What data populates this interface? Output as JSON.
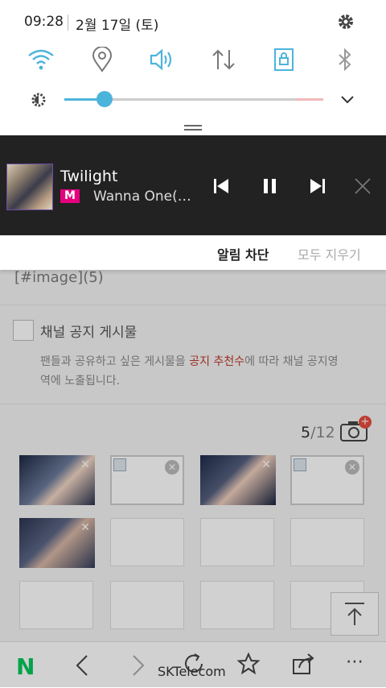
{
  "status": {
    "time": "09:28",
    "date": "2월 17일 (토)"
  },
  "media": {
    "title": "Twilight",
    "artist": "Wanna One(…",
    "app_logo": "M"
  },
  "actions": {
    "block_label": "알림 차단",
    "clear_all_label": "모두 지우기"
  },
  "page": {
    "image_placeholder": "[#image](5)",
    "notice_title": "채널 공지 게시물",
    "notice_desc_part1": "팬들과 공유하고 싶은 게시물을 ",
    "notice_desc_highlight": "공지 추천수",
    "notice_desc_part2": "에 따라 채널 공지영",
    "notice_desc_line2": "역에 노출됩니다.",
    "count_current": "5",
    "count_total": "/12"
  },
  "bottom_bar": {
    "carrier": "SKTelecom"
  },
  "colors": {
    "accent": "#4cb4db",
    "media_bg": "#222222",
    "highlight": "#c0392b",
    "naver_green": "#03c75a"
  },
  "icons": [
    "wifi-icon",
    "location-icon",
    "sound-icon",
    "data-icon",
    "lock-rotation-icon",
    "bluetooth-icon",
    "brightness-icon",
    "gear-icon",
    "chevron-down-icon",
    "prev-icon",
    "pause-icon",
    "next-icon",
    "close-icon",
    "camera-icon",
    "scroll-top-icon"
  ]
}
